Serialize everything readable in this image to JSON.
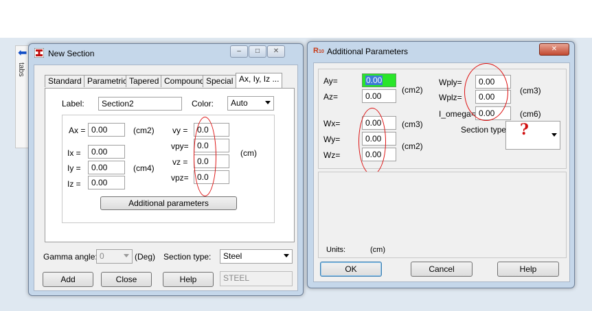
{
  "side_tab": {
    "label": "tabs"
  },
  "new_section": {
    "title": "New Section",
    "tabs": [
      "Standard",
      "Parametric",
      "Tapered",
      "Compound",
      "Special",
      "Ax, Iy, Iz ..."
    ],
    "label_caption": "Label:",
    "label_value": "Section2",
    "color_caption": "Color:",
    "color_value": "Auto",
    "ax": {
      "label": "Ax =",
      "value": "0.00",
      "unit": "(cm2)"
    },
    "ix": {
      "label": "Ix =",
      "value": "0.00"
    },
    "iy": {
      "label": "Iy =",
      "value": "0.00",
      "unit": "(cm4)"
    },
    "iz": {
      "label": "Iz =",
      "value": "0.00"
    },
    "vy": {
      "label": "vy =",
      "value": "0.0"
    },
    "vpy": {
      "label": "vpy=",
      "value": "0.0"
    },
    "vz": {
      "label": "vz =",
      "value": "0.0"
    },
    "vpz": {
      "label": "vpz=",
      "value": "0.0"
    },
    "v_unit": "(cm)",
    "additional_button": "Additional parameters",
    "gamma_caption": "Gamma angle:",
    "gamma_value": "0",
    "gamma_unit": "(Deg)",
    "section_type_caption": "Section type:",
    "section_type_value": "Steel",
    "material_value": "STEEL",
    "add_button": "Add",
    "close_button": "Close",
    "help_button": "Help"
  },
  "additional": {
    "title": "Additional Parameters",
    "ay": {
      "label": "Ay=",
      "value": "0.00"
    },
    "az": {
      "label": "Az=",
      "value": "0.00"
    },
    "a_unit": "(cm2)",
    "wx": {
      "label": "Wx=",
      "value": "0.00",
      "unit": "(cm3)"
    },
    "wy": {
      "label": "Wy=",
      "value": "0.00"
    },
    "wz": {
      "label": "Wz=",
      "value": "0.00"
    },
    "wyz_unit": "(cm2)",
    "wply": {
      "label": "Wply=",
      "value": "0.00"
    },
    "wplz": {
      "label": "Wplz=",
      "value": "0.00"
    },
    "wpl_unit": "(cm3)",
    "iomega": {
      "label": "I_omega=",
      "value": "0.00",
      "unit": "(cm6)"
    },
    "section_type_caption": "Section type:",
    "section_type_symbol": "?",
    "units_caption": "Units:",
    "units_value": "(cm)",
    "ok_button": "OK",
    "cancel_button": "Cancel",
    "help_button": "Help"
  },
  "colors": {
    "highlight_field": "#29e629",
    "annotation_oval": "#d11111",
    "window_frame": "#c5d7ea"
  }
}
